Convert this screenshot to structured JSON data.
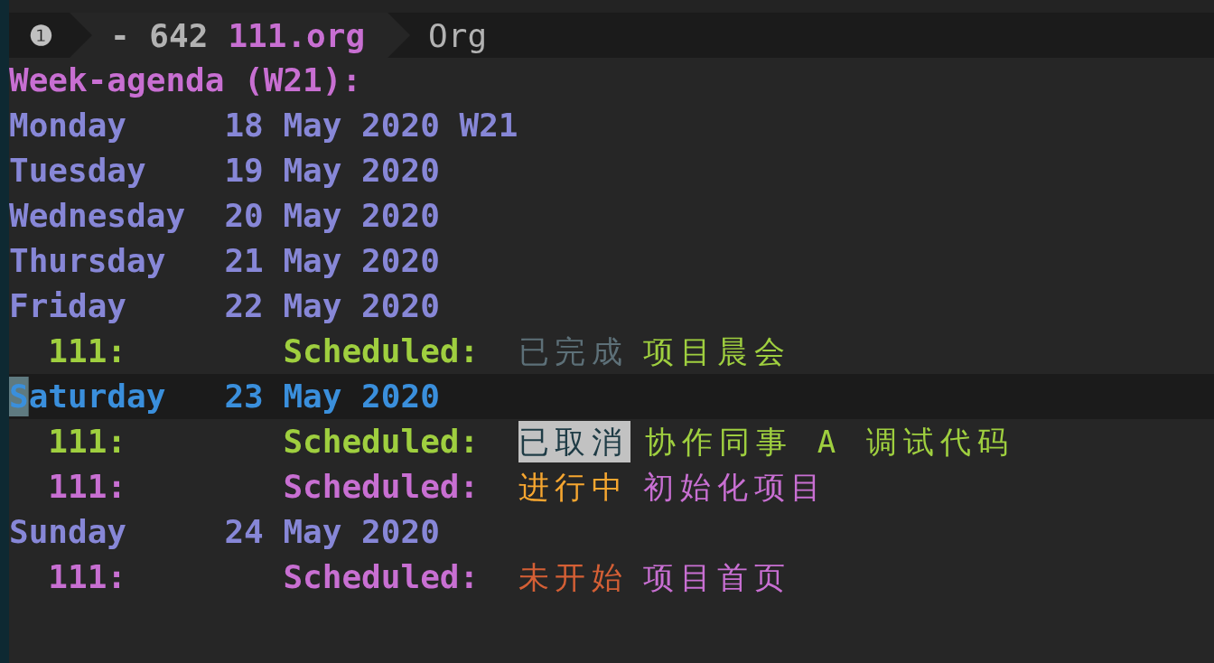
{
  "mode_line": {
    "window_number": "❶",
    "buffer_size": "- 642",
    "buffer_name": "111.org",
    "major_mode": "Org"
  },
  "header": "Week-agenda (W21):",
  "days": [
    {
      "day": "Monday",
      "date": "18 May 2020 W21",
      "current": false
    },
    {
      "day": "Tuesday",
      "date": "19 May 2020",
      "current": false
    },
    {
      "day": "Wednesday",
      "date": "20 May 2020",
      "current": false
    },
    {
      "day": "Thursday",
      "date": "21 May 2020",
      "current": false
    },
    {
      "day": "Friday",
      "date": "22 May 2020",
      "current": false,
      "entries": [
        {
          "category": "111:",
          "label": "Scheduled:",
          "state": "已完成",
          "kind": "done",
          "title": "项目晨会",
          "color": "#9fcf3f"
        }
      ]
    },
    {
      "day": "Saturday",
      "date": "23 May 2020",
      "current": true,
      "entries": [
        {
          "category": "111:",
          "label": "Scheduled:",
          "state": "已取消",
          "kind": "cancelled",
          "title": "协作同事 A 调试代码",
          "color": "#9fcf3f"
        },
        {
          "category": "111:",
          "label": "Scheduled:",
          "state": "进行中",
          "kind": "progress",
          "title": "初始化项目",
          "color": "#c86fd2"
        }
      ]
    },
    {
      "day": "Sunday",
      "date": "24 May 2020",
      "current": false,
      "entries": [
        {
          "category": "111:",
          "label": "Scheduled:",
          "state": "未开始",
          "kind": "todo",
          "title": "项目首页",
          "color": "#c86fd2"
        }
      ]
    }
  ]
}
